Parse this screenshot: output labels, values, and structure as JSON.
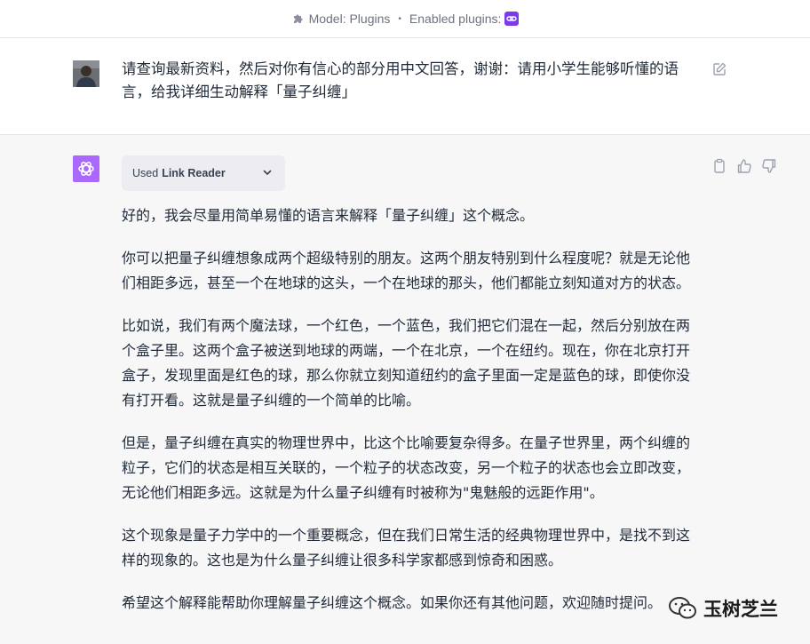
{
  "topbar": {
    "model_label": "Model: Plugins",
    "separator": "•",
    "enabled_label": "Enabled plugins:",
    "icons": [
      "puzzle-icon",
      "link-plugin-icon"
    ]
  },
  "user_message": {
    "text": "请查询最新资料，然后对你有信心的部分用中文回答，谢谢：请用小学生能够听懂的语言，给我详细生动解释「量子纠缠」"
  },
  "assistant": {
    "tool_chip": {
      "used": "Used",
      "tool_name": "Link Reader"
    },
    "paragraphs": [
      "好的，我会尽量用简单易懂的语言来解释「量子纠缠」这个概念。",
      "你可以把量子纠缠想象成两个超级特别的朋友。这两个朋友特别到什么程度呢？就是无论他们相距多远，甚至一个在地球的这头，一个在地球的那头，他们都能立刻知道对方的状态。",
      "比如说，我们有两个魔法球，一个红色，一个蓝色，我们把它们混在一起，然后分别放在两个盒子里。这两个盒子被送到地球的两端，一个在北京，一个在纽约。现在，你在北京打开盒子，发现里面是红色的球，那么你就立刻知道纽约的盒子里面一定是蓝色的球，即使你没有打开看。这就是量子纠缠的一个简单的比喻。",
      "但是，量子纠缠在真实的物理世界中，比这个比喻要复杂得多。在量子世界里，两个纠缠的粒子，它们的状态是相互关联的，一个粒子的状态改变，另一个粒子的状态也会立即改变，无论他们相距多远。这就是为什么量子纠缠有时被称为\"鬼魅般的远距作用\"。",
      "这个现象是量子力学中的一个重要概念，但在我们日常生活的经典物理世界中，是找不到这样的现象的。这也是为什么量子纠缠让很多科学家都感到惊奇和困惑。",
      "希望这个解释能帮助你理解量子纠缠这个概念。如果你还有其他问题，欢迎随时提问。"
    ],
    "action_icons": [
      "copy-icon",
      "thumbs-up-icon",
      "thumbs-down-icon"
    ]
  },
  "watermark": {
    "text": "玉树芝兰"
  },
  "colors": {
    "gpt_avatar": "#ab68ff",
    "plugin_badge": "#7c3aed",
    "assistant_bg": "#f7f7f8",
    "chip_bg": "#ececf1"
  }
}
